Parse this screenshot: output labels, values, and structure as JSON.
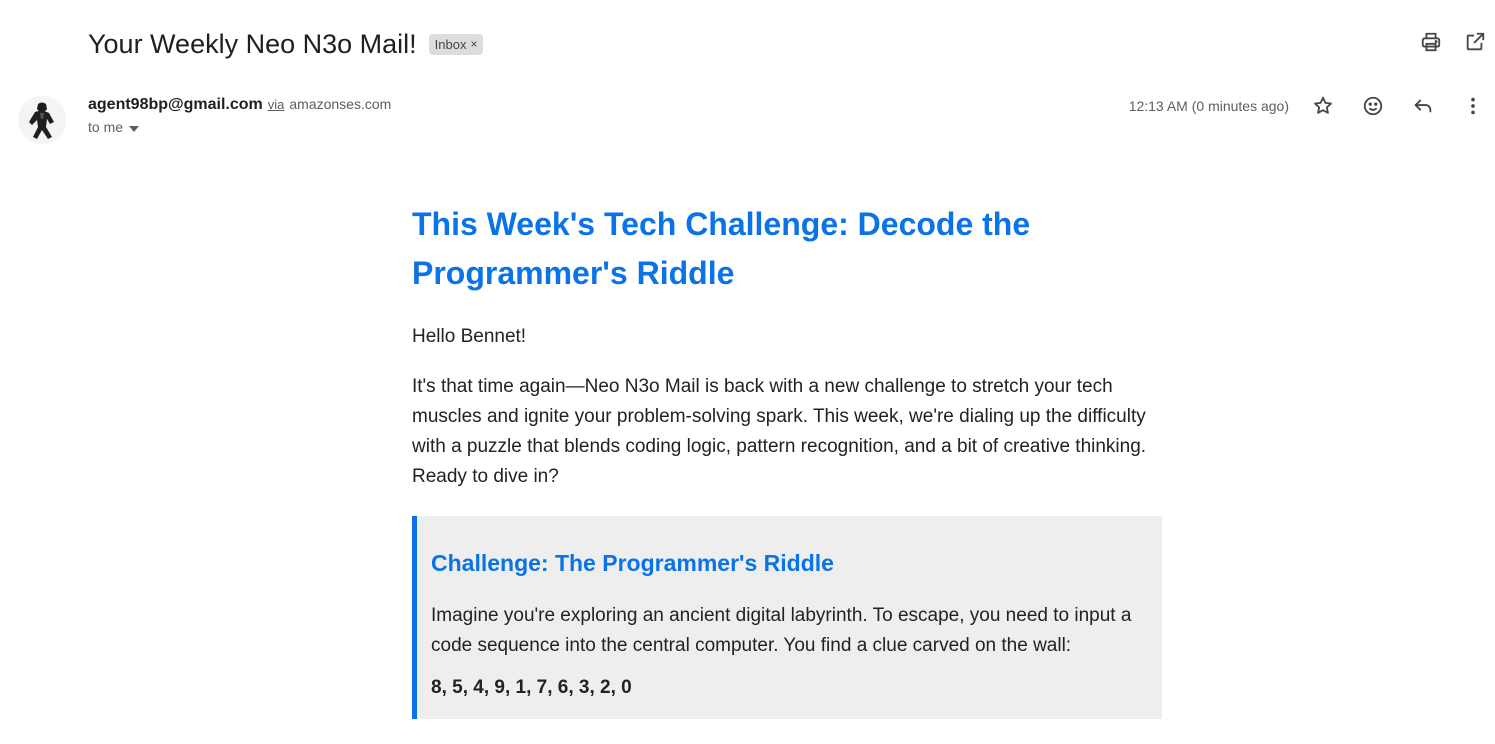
{
  "email": {
    "subject": "Your Weekly Neo N3o Mail!",
    "label": "Inbox",
    "label_remove": "×",
    "sender_email": "agent98bp@gmail.com",
    "via_text": "via",
    "via_domain": "amazonses.com",
    "recipient": "to me",
    "timestamp": "12:13 AM (0 minutes ago)"
  },
  "icons": {
    "top": [
      "print-icon",
      "open-in-new-window-icon"
    ],
    "meta": [
      "star-icon",
      "emoji-reaction-icon",
      "reply-icon",
      "more-options-icon"
    ],
    "avatar": "panther-avatar"
  },
  "body": {
    "heading": "This Week's Tech Challenge: Decode the Programmer's Riddle",
    "greeting": "Hello Bennet!",
    "intro": "It's that time again—Neo N3o Mail is back with a new challenge to stretch your tech muscles and ignite your problem-solving spark. This week, we're dialing up the difficulty with a puzzle that blends coding logic, pattern recognition, and a bit of creative thinking. Ready to dive in?",
    "challenge": {
      "title": "Challenge: The Programmer's Riddle",
      "text": "Imagine you're exploring an ancient digital labyrinth. To escape, you need to input a code sequence into the central computer. You find a clue carved on the wall:",
      "sequence": "8, 5, 4, 9, 1, 7, 6, 3, 2, 0"
    }
  },
  "colors": {
    "accent": "#0a73e8",
    "box_background": "#eeeeee",
    "chip_background": "#dddddd"
  }
}
